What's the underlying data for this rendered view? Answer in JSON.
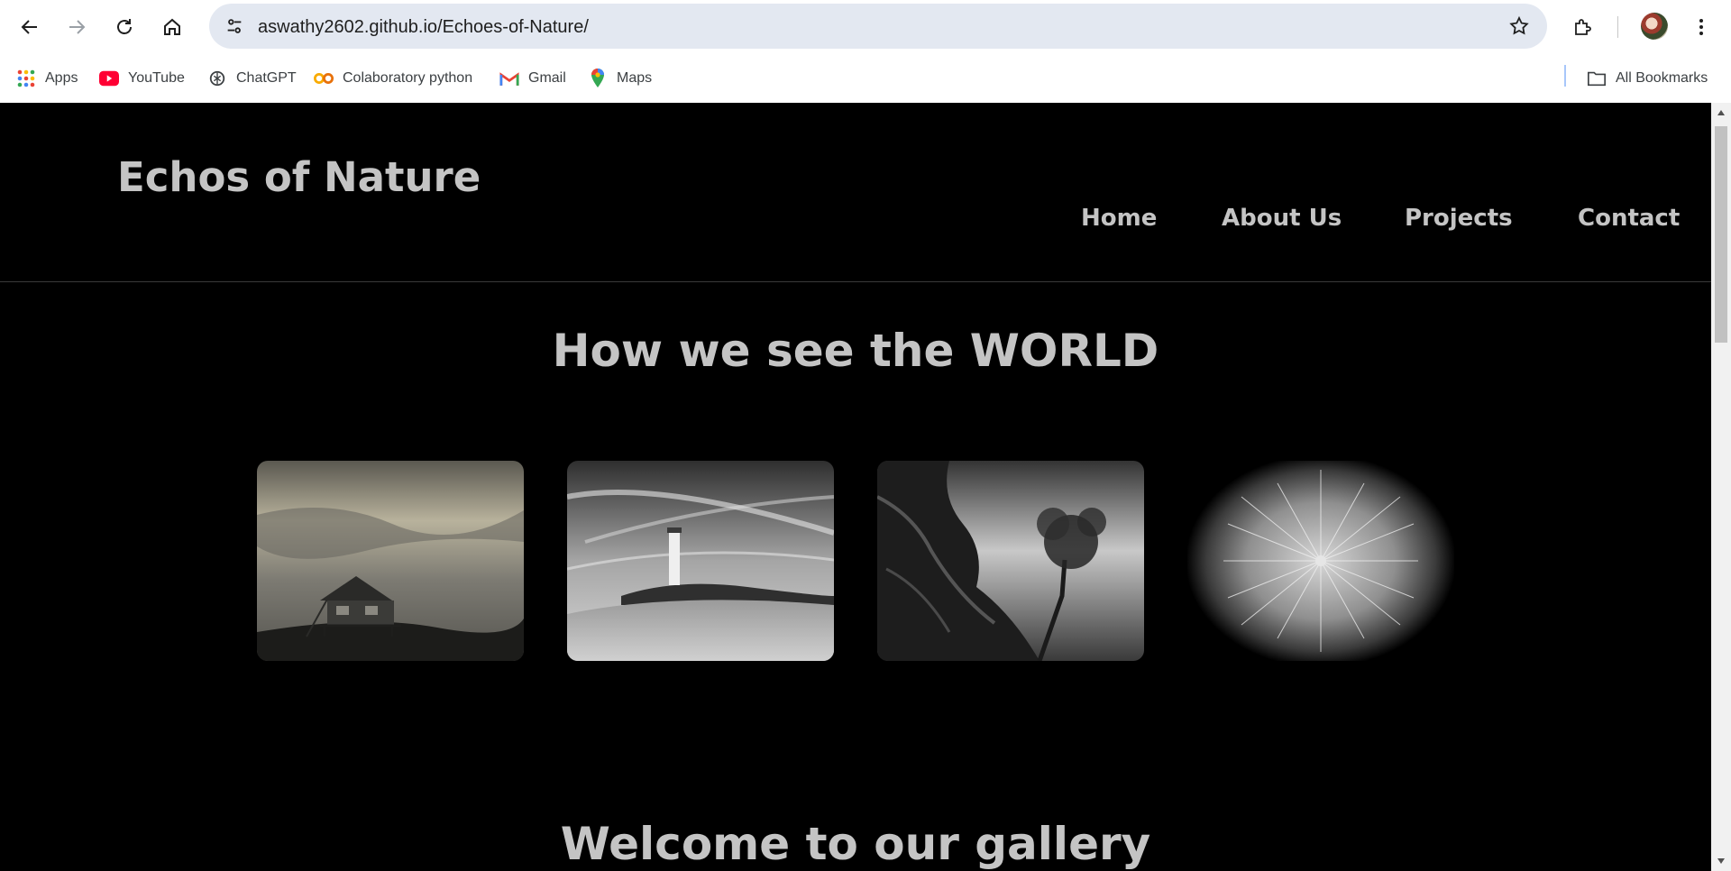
{
  "browser": {
    "url": "aswathy2602.github.io/Echoes-of-Nature/",
    "bookmarks": [
      {
        "label": "Apps",
        "icon": "apps-grid-icon"
      },
      {
        "label": "YouTube",
        "icon": "youtube-icon"
      },
      {
        "label": "ChatGPT",
        "icon": "chatgpt-icon"
      },
      {
        "label": "Colaboratory python",
        "icon": "colab-icon"
      },
      {
        "label": "Gmail",
        "icon": "gmail-icon"
      },
      {
        "label": "Maps",
        "icon": "maps-icon"
      }
    ],
    "all_bookmarks": "All Bookmarks"
  },
  "site": {
    "logo": "Echos of Nature",
    "nav": [
      "Home",
      "About Us",
      "Projects",
      "Contact"
    ],
    "section_title": "How we see the WORLD",
    "gallery_title": "Welcome to our gallery",
    "photos": [
      "house-on-hill-photo",
      "lighthouse-photo",
      "rock-and-tree-photo",
      "dandelion-photo"
    ]
  },
  "colors": {
    "page_background": "#000000",
    "text": "#c4c4c4",
    "omnibox": "#e3e8f1"
  }
}
